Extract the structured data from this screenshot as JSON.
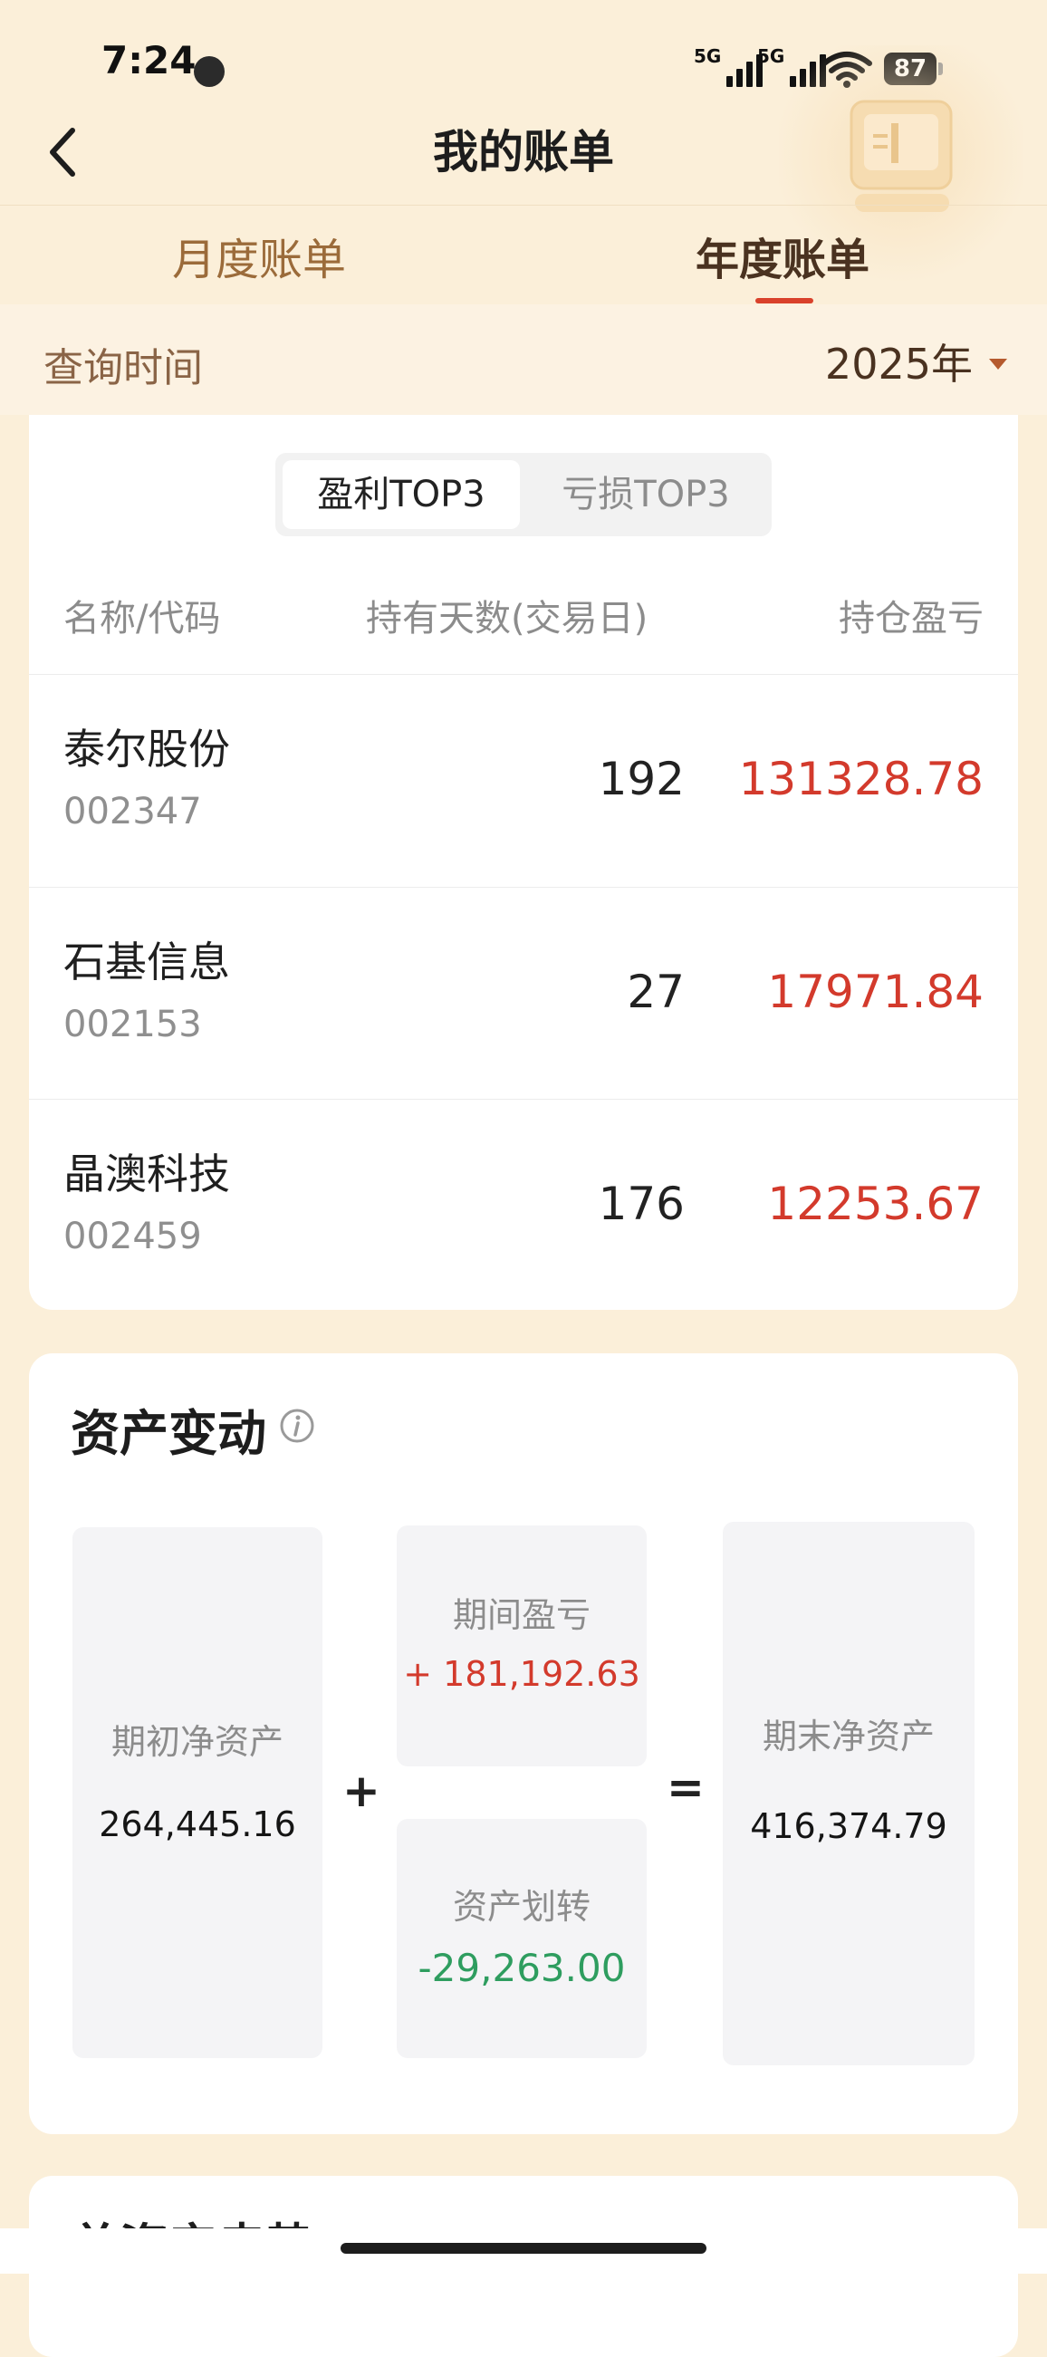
{
  "status_bar": {
    "time": "7:24",
    "signal1_label": "5G",
    "signal2_label": "5G",
    "battery": "87"
  },
  "header": {
    "title": "我的账单"
  },
  "tabs": [
    {
      "label": "月度账单",
      "active": false
    },
    {
      "label": "年度账单",
      "active": true
    }
  ],
  "query": {
    "label": "查询时间",
    "year": "2025年"
  },
  "top3": {
    "segments": [
      {
        "label": "盈利TOP3",
        "active": true
      },
      {
        "label": "亏损TOP3",
        "active": false
      }
    ],
    "columns": {
      "name": "名称/代码",
      "days": "持有天数(交易日)",
      "pnl": "持仓盈亏"
    },
    "rows": [
      {
        "name": "泰尔股份",
        "code": "002347",
        "days": "192",
        "pnl": "131328.78"
      },
      {
        "name": "石基信息",
        "code": "002153",
        "days": "27",
        "pnl": "17971.84"
      },
      {
        "name": "晶澳科技",
        "code": "002459",
        "days": "176",
        "pnl": "12253.67"
      }
    ]
  },
  "asset_change": {
    "title": "资产变动",
    "initial": {
      "label": "期初净资产",
      "value": "264,445.16"
    },
    "period_pnl": {
      "label": "期间盈亏",
      "value": "+  181,192.63"
    },
    "transfer": {
      "label": "资产划转",
      "value": "-29,263.00"
    },
    "final": {
      "label": "期末净资产",
      "value": "416,374.79"
    },
    "plus": "+",
    "equals": "="
  },
  "next_section": {
    "title": "总资产走势"
  },
  "colors": {
    "background": "#fbefd9",
    "accent_red": "#d33a2c",
    "accent_green": "#2e9d5f",
    "tab_indicator": "#d9412b"
  }
}
